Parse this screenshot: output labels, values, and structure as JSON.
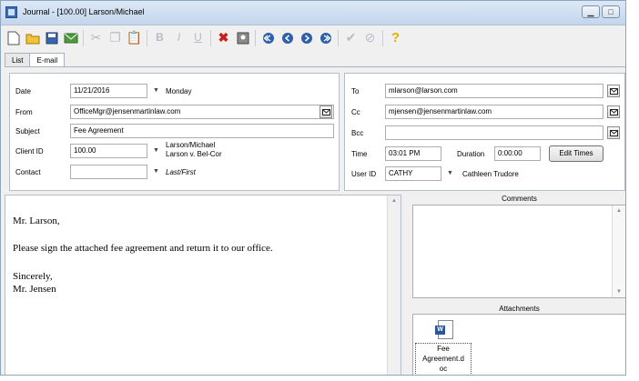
{
  "window": {
    "title": "Journal - [100.00] Larson/Michael"
  },
  "tabs": [
    {
      "label": "List"
    },
    {
      "label": "E-mail"
    }
  ],
  "left_panel": {
    "date_label": "Date",
    "date_value": "11/21/2016",
    "weekday": "Monday",
    "from_label": "From",
    "from_value": "OfficeMgr@jensenmartinlaw.com",
    "subject_label": "Subject",
    "subject_value": "Fee Agreement",
    "client_id_label": "Client ID",
    "client_id_value": "100.00",
    "client_name": "Larson/Michael",
    "client_matter": "Larson v. Bel-Cor",
    "contact_label": "Contact",
    "contact_value": "",
    "contact_hint": "Last/First"
  },
  "right_panel": {
    "to_label": "To",
    "to_value": "mlarson@larson.com",
    "cc_label": "Cc",
    "cc_value": "mjensen@jensenmartinlaw.com",
    "bcc_label": "Bcc",
    "bcc_value": "",
    "time_label": "Time",
    "time_value": "03:01 PM",
    "duration_label": "Duration",
    "duration_value": "0:00:00",
    "edit_times_label": "Edit Times",
    "user_id_label": "User ID",
    "user_id_value": "CATHY",
    "user_name": "Cathleen Trudore"
  },
  "message": {
    "greeting": "Mr. Larson,",
    "line1": "Please sign the attached fee agreement and return it to our office.",
    "closing": "Sincerely,",
    "signature": "Mr. Jensen"
  },
  "comments": {
    "title": "Comments"
  },
  "attachments": {
    "title": "Attachments",
    "items": [
      {
        "name_line1": "Fee",
        "name_line2": "Agreement.d",
        "name_line3": "oc"
      }
    ]
  },
  "colors": {
    "title_bar": "#c4d6ec",
    "accent": "#2b579a"
  }
}
